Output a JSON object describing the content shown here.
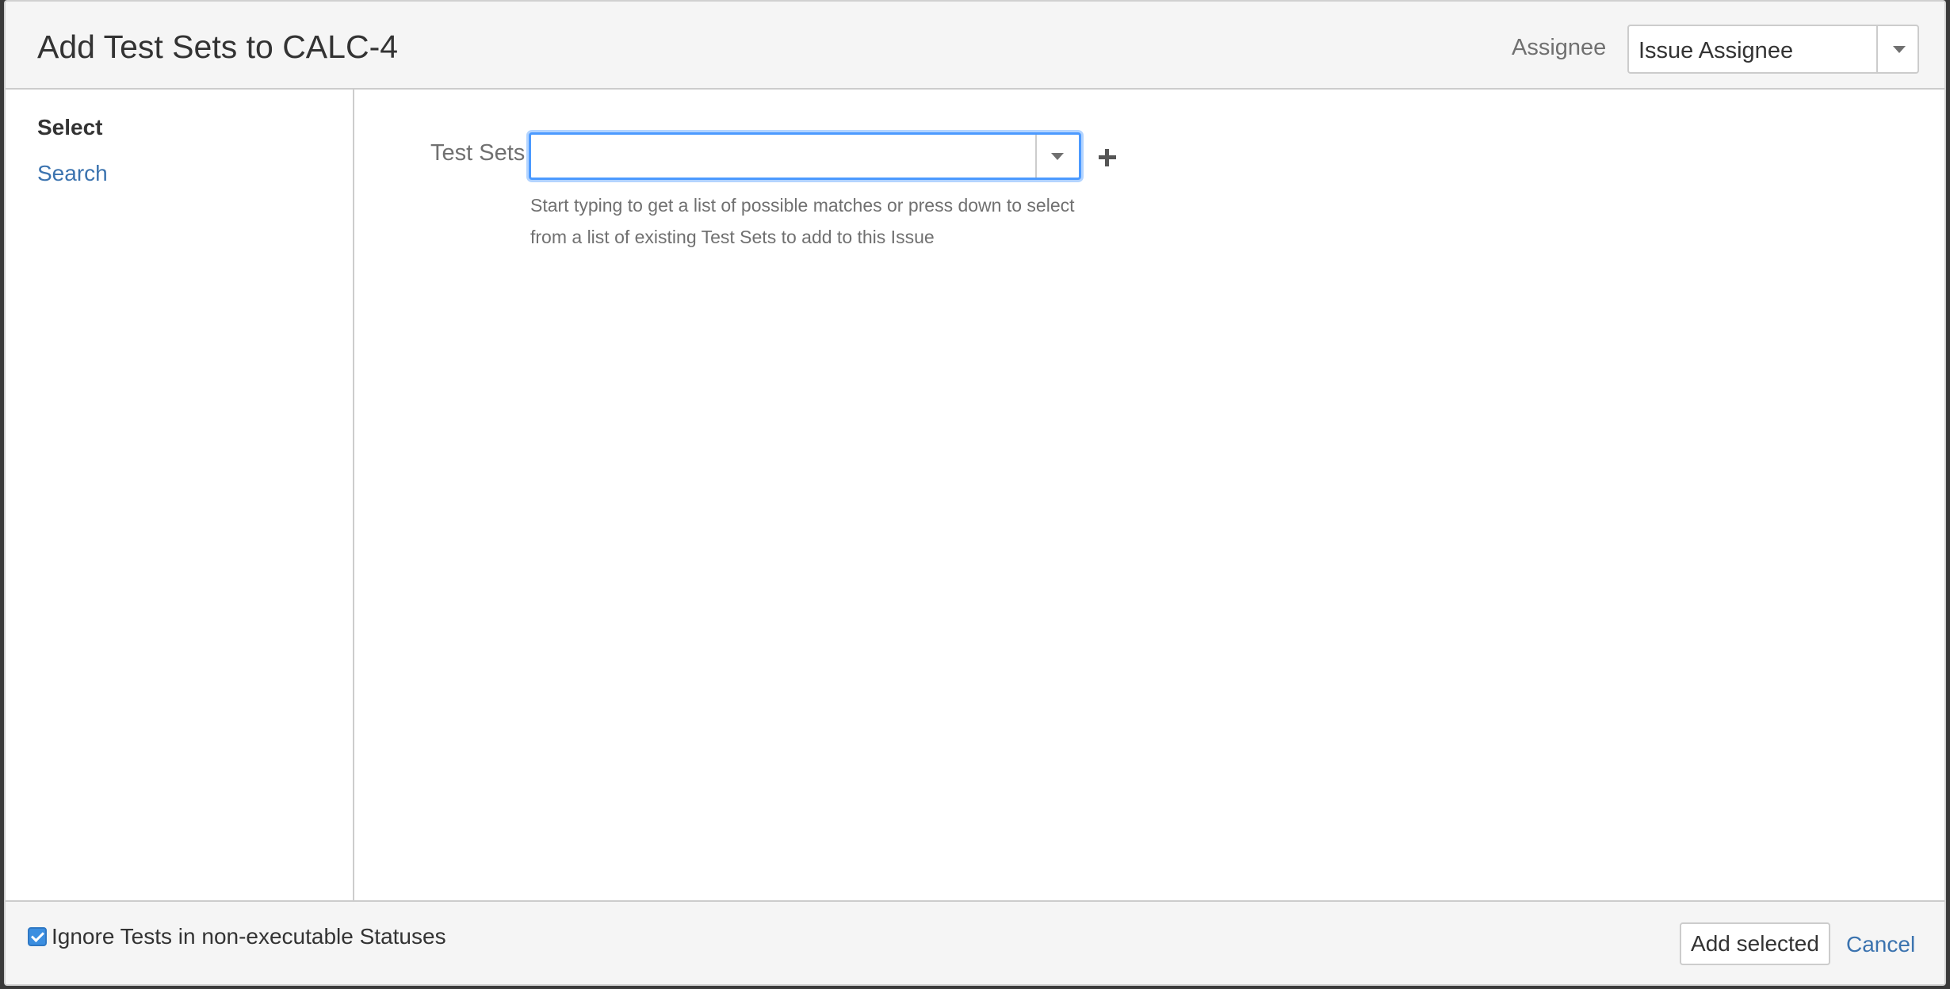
{
  "header": {
    "title": "Add Test Sets to CALC-4",
    "assignee_label": "Assignee",
    "assignee_value": "Issue Assignee"
  },
  "sidebar": {
    "items": [
      {
        "label": "Select",
        "active": true
      },
      {
        "label": "Search",
        "active": false
      }
    ]
  },
  "main": {
    "field_label": "Test Sets",
    "input_value": "",
    "help_text": "Start typing to get a list of possible matches or press down to select from a list of existing Test Sets to add to this Issue"
  },
  "footer": {
    "checkbox_checked": true,
    "checkbox_label": "Ignore Tests in non-executable Statuses",
    "add_button_label": "Add selected",
    "cancel_label": "Cancel"
  },
  "colors": {
    "link": "#3b73af",
    "focus": "#4c9aff",
    "checkbox": "#3b8ee0"
  },
  "icons": [
    "chevron-down-icon",
    "plus-icon",
    "checkbox-checked-icon"
  ]
}
